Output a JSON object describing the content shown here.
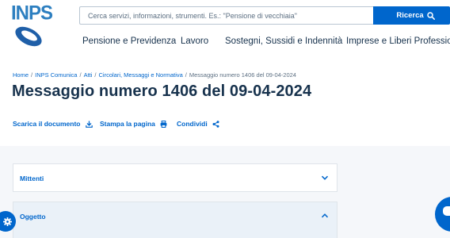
{
  "logo": {
    "text": "INPS"
  },
  "search": {
    "placeholder": "Cerca servizi, informazioni, strumenti. Es.: \"Pensione di vecchiaia\"",
    "button_label": "Ricerca"
  },
  "nav": {
    "items": [
      {
        "label": "Pensione e Previdenza"
      },
      {
        "label": "Lavoro"
      },
      {
        "label": "Sostegni, Sussidi e Indennità"
      },
      {
        "label": "Imprese e Liberi Professionisti"
      }
    ]
  },
  "breadcrumb": {
    "items": [
      {
        "label": "Home"
      },
      {
        "label": "INPS Comunica"
      },
      {
        "label": "Atti"
      },
      {
        "label": "Circolari, Messaggi e Normativa"
      }
    ],
    "current": "Messaggio numero 1406 del 09-04-2024",
    "separator": "/"
  },
  "page": {
    "title": "Messaggio numero 1406 del 09-04-2024"
  },
  "actions": {
    "download": "Scarica il documento",
    "print": "Stampa la pagina",
    "share": "Condividi"
  },
  "accordions": [
    {
      "label": "Mittenti",
      "state": "collapsed"
    },
    {
      "label": "Oggetto",
      "state": "expanded"
    }
  ],
  "colors": {
    "brand": "#0066cc",
    "text": "#17324d",
    "muted": "#5c6f82",
    "logo": "#2d7fc0"
  },
  "icons": {
    "search": "search-icon",
    "download": "download-icon",
    "print": "print-icon",
    "share": "share-icon",
    "chevron_down": "chevron-down-icon",
    "chevron_up": "chevron-up-icon",
    "settings": "gear-icon",
    "chat": "chat-icon"
  }
}
